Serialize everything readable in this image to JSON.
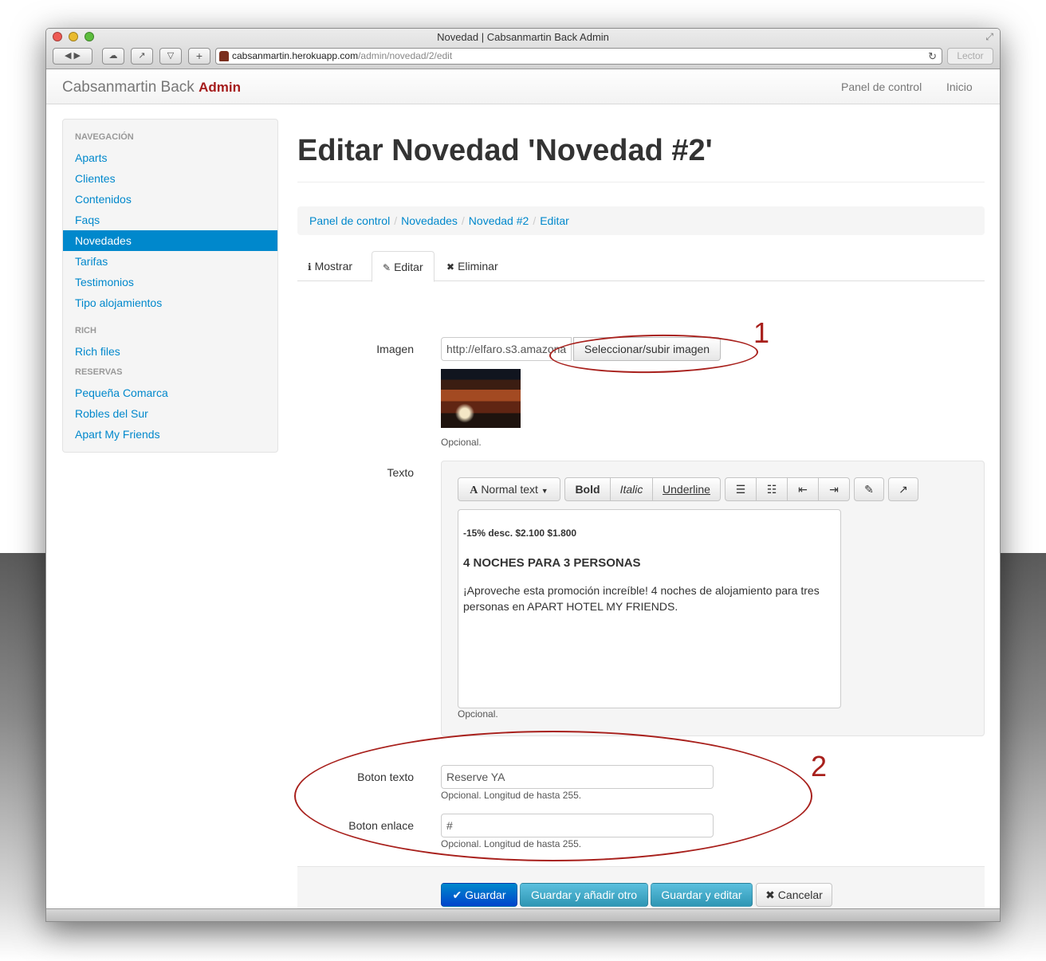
{
  "window": {
    "title": "Novedad | Cabsanmartin Back Admin"
  },
  "browser": {
    "url_host": "cabsanmartin.herokuapp.com",
    "url_path": "/admin/novedad/2/edit",
    "reader_label": "Lector",
    "add_label": "+",
    "back_label": "◀ ▶"
  },
  "navbar": {
    "brand": "Cabsanmartin Back",
    "brand_strong": "Admin",
    "links": [
      "Panel de control",
      "Inicio"
    ]
  },
  "sidebar": {
    "sections": [
      {
        "header": "NAVEGACIÓN",
        "items": [
          "Aparts",
          "Clientes",
          "Contenidos",
          "Faqs",
          "Novedades",
          "Tarifas",
          "Testimonios",
          "Tipo alojamientos"
        ]
      },
      {
        "header": "RICH",
        "items": [
          "Rich files"
        ]
      },
      {
        "header": "RESERVAS",
        "items": [
          "Pequeña Comarca",
          "Robles del Sur",
          "Apart My Friends"
        ]
      }
    ],
    "active_item": "Novedades"
  },
  "page": {
    "title": "Editar Novedad 'Novedad #2'"
  },
  "breadcrumb": [
    "Panel de control",
    "Novedades",
    "Novedad #2",
    "Editar"
  ],
  "tabs": [
    "Mostrar",
    "Editar",
    "Eliminar"
  ],
  "form": {
    "imagen": {
      "label": "Imagen",
      "value": "http://elfaro.s3.amazona",
      "button": "Seleccionar/subir imagen",
      "help": "Opcional."
    },
    "texto": {
      "label": "Texto",
      "toolbar": [
        "Normal text",
        "Bold",
        "Italic",
        "Underline"
      ],
      "content_small": "-15% desc. $2.100   $1.800",
      "content_heading": "4 NOCHES PARA 3 PERSONAS",
      "content_body": "¡Aproveche esta promoción increíble! 4 noches de alojamiento para tres personas en APART HOTEL MY FRIENDS.",
      "help": "Opcional."
    },
    "boton_texto": {
      "label": "Boton texto",
      "value": "Reserve YA",
      "help": "Opcional. Longitud de hasta 255."
    },
    "boton_enlace": {
      "label": "Boton enlace",
      "value": "#",
      "help": "Opcional. Longitud de hasta 255."
    }
  },
  "actions": [
    "Guardar",
    "Guardar y añadir otro",
    "Guardar y editar",
    "Cancelar"
  ],
  "annotations": [
    "1",
    "2"
  ],
  "colors": {
    "link": "#0088cc",
    "brand_admin": "#a51c1c",
    "annotation": "#a8201c",
    "primary": "#0088cc",
    "info": "#5bc0de"
  }
}
